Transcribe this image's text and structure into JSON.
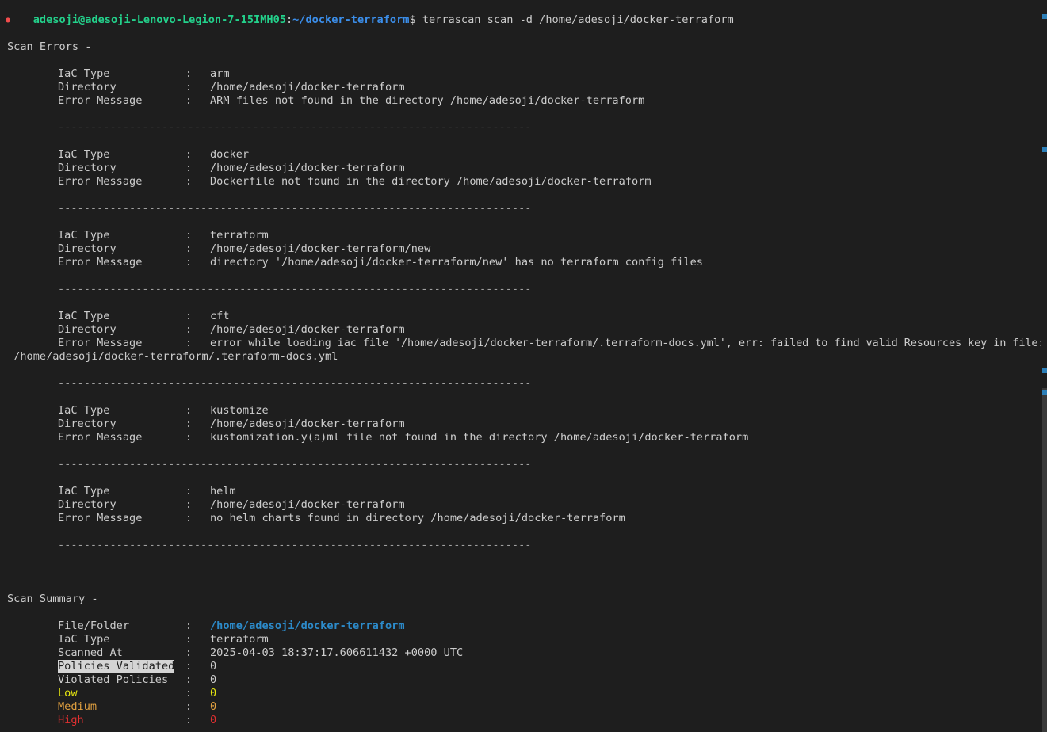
{
  "prompt": {
    "user_host": "adesoji@adesoji-Lenovo-Legion-7-15IMH05",
    "separator": ":",
    "path": "~/docker-terraform",
    "symbol": "$",
    "command": " terrascan scan -d /home/adesoji/docker-terraform"
  },
  "scan_errors": {
    "heading": "Scan Errors -",
    "labels": {
      "iac_type": "IaC Type",
      "directory": "Directory",
      "error_message": "Error Message"
    },
    "colon": ":",
    "divider": "-------------------------------------------------------------------------",
    "entries": [
      {
        "iac_type": "arm",
        "directory": "/home/adesoji/docker-terraform",
        "error_message": "ARM files not found in the directory /home/adesoji/docker-terraform"
      },
      {
        "iac_type": "docker",
        "directory": "/home/adesoji/docker-terraform",
        "error_message": "Dockerfile not found in the directory /home/adesoji/docker-terraform"
      },
      {
        "iac_type": "terraform",
        "directory": "/home/adesoji/docker-terraform/new",
        "error_message": "directory '/home/adesoji/docker-terraform/new' has no terraform config files"
      },
      {
        "iac_type": "cft",
        "directory": "/home/adesoji/docker-terraform",
        "error_message": "error while loading iac file '/home/adesoji/docker-terraform/.terraform-docs.yml', err: failed to find valid Resources key in file:",
        "error_message_wrap": " /home/adesoji/docker-terraform/.terraform-docs.yml"
      },
      {
        "iac_type": "kustomize",
        "directory": "/home/adesoji/docker-terraform",
        "error_message": "kustomization.y(a)ml file not found in the directory /home/adesoji/docker-terraform"
      },
      {
        "iac_type": "helm",
        "directory": "/home/adesoji/docker-terraform",
        "error_message": "no helm charts found in directory /home/adesoji/docker-terraform"
      }
    ]
  },
  "scan_summary": {
    "heading": "Scan Summary -",
    "file_folder_label": "File/Folder",
    "file_folder": "/home/adesoji/docker-terraform",
    "iac_type_label": "IaC Type",
    "iac_type": "terraform",
    "scanned_at_label": "Scanned At",
    "scanned_at": "2025-04-03 18:37:17.606611432 +0000 UTC",
    "policies_validated_label": "Policies Validated",
    "policies_validated": "0",
    "violated_policies_label": "Violated Policies",
    "violated_policies": "0",
    "low_label": "Low",
    "low": "0",
    "medium_label": "Medium",
    "medium": "0",
    "high_label": "High",
    "high": "0"
  },
  "colors": {
    "background": "#1e1e1e",
    "prompt_user": "#23d18b",
    "prompt_path": "#3b8eea",
    "low": "#e5e510",
    "medium": "#e0a040",
    "high": "#e03030"
  }
}
